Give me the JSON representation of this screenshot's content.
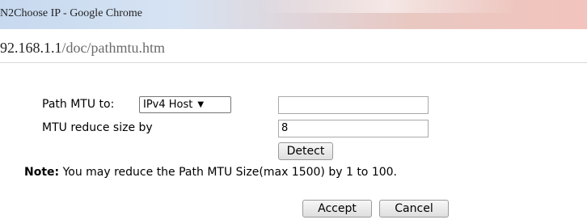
{
  "window": {
    "title": "N2Choose IP - Google Chrome",
    "url_host": "92.168.1.1",
    "url_path": "/doc/pathmtu.htm"
  },
  "form": {
    "path_mtu_label": "Path MTU to:",
    "path_mtu_select_value": "IPv4 Host",
    "path_mtu_input_value": "",
    "mtu_reduce_label": "MTU reduce size by",
    "mtu_reduce_value": "8",
    "detect_label": "Detect",
    "note_label": "Note:",
    "note_text": " You may reduce the Path MTU Size(max 1500) by 1 to 100.",
    "accept_label": "Accept",
    "cancel_label": "Cancel"
  }
}
